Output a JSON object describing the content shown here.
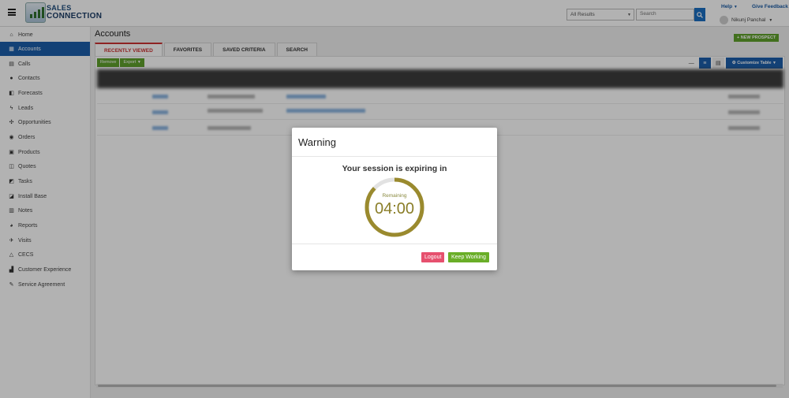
{
  "app": {
    "logo_line1": "SALES",
    "logo_line2": "CONNECTION"
  },
  "header": {
    "search_scope": "All Results",
    "search_placeholder": "Search",
    "help_label": "Help",
    "feedback_label": "Give Feedback",
    "user_name": "Nikunj Panchal"
  },
  "sidebar": {
    "items": [
      {
        "label": "Home",
        "icon": "home-icon"
      },
      {
        "label": "Accounts",
        "icon": "building-icon",
        "active": true
      },
      {
        "label": "Calls",
        "icon": "phone-icon"
      },
      {
        "label": "Contacts",
        "icon": "contacts-icon"
      },
      {
        "label": "Forecasts",
        "icon": "forecast-icon"
      },
      {
        "label": "Leads",
        "icon": "bolt-icon"
      },
      {
        "label": "Opportunities",
        "icon": "handshake-icon"
      },
      {
        "label": "Orders",
        "icon": "cart-icon"
      },
      {
        "label": "Products",
        "icon": "box-icon"
      },
      {
        "label": "Quotes",
        "icon": "quote-icon"
      },
      {
        "label": "Tasks",
        "icon": "task-icon"
      },
      {
        "label": "Install Base",
        "icon": "install-icon"
      },
      {
        "label": "Notes",
        "icon": "notes-icon"
      },
      {
        "label": "Reports",
        "icon": "pie-icon"
      },
      {
        "label": "Visits",
        "icon": "plane-icon"
      },
      {
        "label": "CECS",
        "icon": "triangle-icon"
      },
      {
        "label": "Customer Experience",
        "icon": "chart-icon"
      },
      {
        "label": "Service Agreement",
        "icon": "edit-icon"
      }
    ]
  },
  "main": {
    "title": "Accounts",
    "new_prospect_label": "+ NEW PROSPECT",
    "tabs": [
      {
        "label": "RECENTLY VIEWED",
        "active": true
      },
      {
        "label": "FAVORITES"
      },
      {
        "label": "SAVED CRITERIA"
      },
      {
        "label": "SEARCH"
      }
    ],
    "toolbar": {
      "remove_label": "Remove",
      "export_label": "Export",
      "customize_label": "Customize Table"
    }
  },
  "modal": {
    "title": "Warning",
    "message": "Your session is expiring in",
    "timer_label": "Remaining",
    "timer_value": "04:00",
    "logout_label": "Logout",
    "keep_working_label": "Keep Working",
    "ring_color": "#9a8a2e",
    "progress_fraction": 0.87
  },
  "colors": {
    "accent": "#1c5ea9",
    "green": "#5fa12b",
    "logout": "#e6506e",
    "tab_active": "#cc3333"
  }
}
